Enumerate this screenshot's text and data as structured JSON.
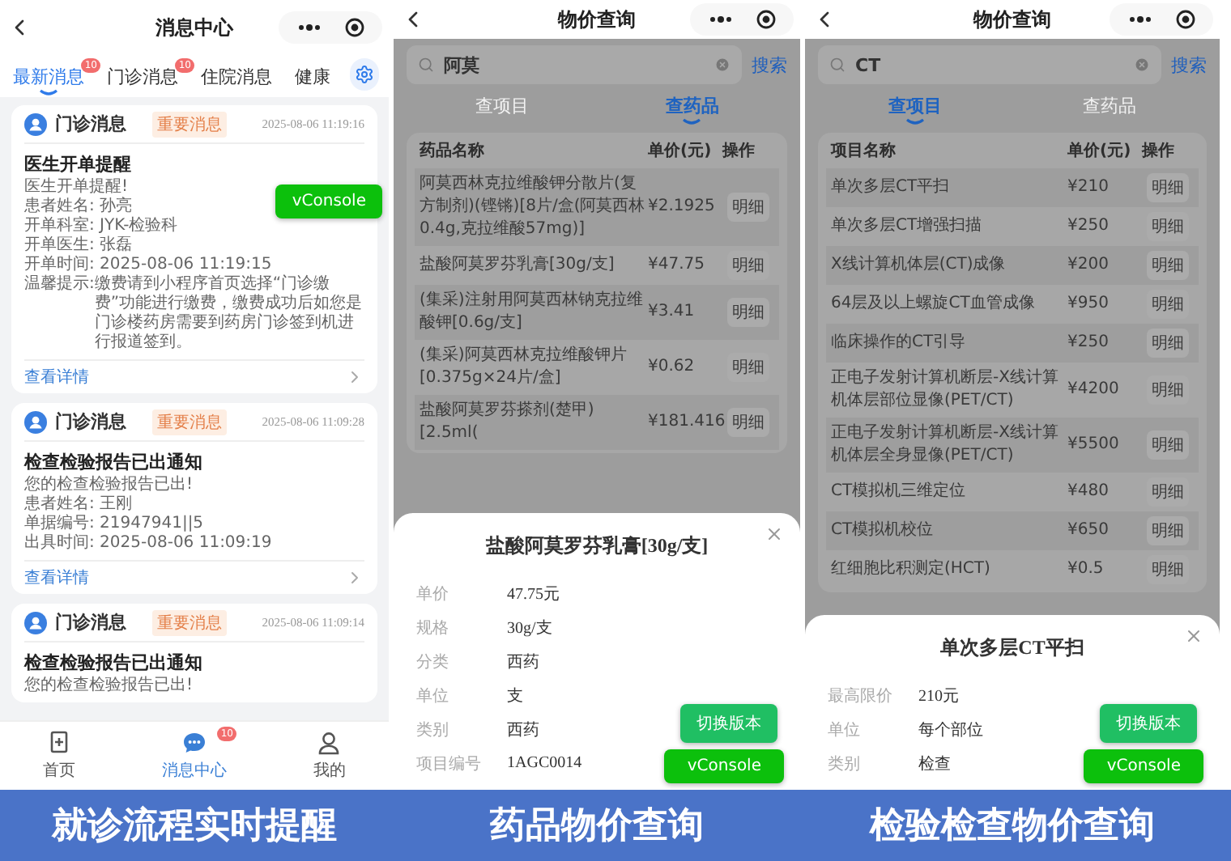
{
  "panels": [
    {
      "kind": "messages",
      "title": "消息中心",
      "caption": "就诊流程实时提醒",
      "tabs": [
        {
          "label": "最新消息",
          "selected": true,
          "badge": "10"
        },
        {
          "label": "门诊消息",
          "selected": false,
          "badge": "10"
        },
        {
          "label": "住院消息",
          "selected": false
        },
        {
          "label": "健康",
          "selected": false
        }
      ],
      "cards": [
        {
          "category": "门诊消息",
          "tag": "重要消息",
          "time": "2025-08-06 11:19:16",
          "heading": "医生开单提醒",
          "lines": [
            {
              "text": "医生开单提醒!"
            },
            {
              "text": "患者姓名: 孙亮"
            },
            {
              "text": "开单科室: JYK-检验科"
            },
            {
              "text": "开单医生: 张磊"
            },
            {
              "text": "开单时间: 2025-08-06 11:19:15"
            },
            {
              "label": "温馨提示:",
              "text": "缴费请到小程序首页选择“门诊缴费”功能进行缴费，缴费成功后如您是门诊楼药房需要到药房门诊签到机进行报道签到。"
            }
          ],
          "link": "查看详情"
        },
        {
          "category": "门诊消息",
          "tag": "重要消息",
          "time": "2025-08-06 11:09:28",
          "heading": "检查检验报告已出通知",
          "lines": [
            {
              "text": "您的检查检验报告已出!"
            },
            {
              "text": "患者姓名: 王刚"
            },
            {
              "text": "单据编号: 21947941||5"
            },
            {
              "text": "出具时间: 2025-08-06 11:09:19"
            }
          ],
          "link": "查看详情"
        },
        {
          "category": "门诊消息",
          "tag": "重要消息",
          "time": "2025-08-06 11:09:14",
          "heading": "检查检验报告已出通知",
          "lines": [
            {
              "text": "您的检查检验报告已出!"
            }
          ]
        }
      ],
      "nav": [
        {
          "label": "首页",
          "selected": false
        },
        {
          "label": "消息中心",
          "selected": true,
          "badge": "10"
        },
        {
          "label": "我的",
          "selected": false
        }
      ],
      "buttons": [
        {
          "label": "vConsole",
          "kind": "console"
        }
      ]
    },
    {
      "kind": "price",
      "title": "物价查询",
      "caption": "药品物价查询",
      "query": "阿莫",
      "search_button": "搜索",
      "tabs": [
        {
          "label": "查项目",
          "selected": false
        },
        {
          "label": "查药品",
          "selected": true
        }
      ],
      "columns": [
        "药品名称",
        "单价(元)",
        "操作"
      ],
      "rows": [
        {
          "name": "阿莫西林克拉维酸钾分散片(复方制剂)(铿锵)[8片/盒(阿莫西林0.4g,克拉维酸57mg)]",
          "price": "¥2.1925",
          "action": "明细"
        },
        {
          "name": "盐酸阿莫罗芬乳膏[30g/支]",
          "price": "¥47.75",
          "action": "明细"
        },
        {
          "name": "(集采)注射用阿莫西林钠克拉维酸钾[0.6g/支]",
          "price": "¥3.41",
          "action": "明细"
        },
        {
          "name": "(集采)阿莫西林克拉维酸钾片[0.375g×24片/盒]",
          "price": "¥0.62",
          "action": "明细"
        },
        {
          "name": "盐酸阿莫罗芬搽剂(楚甲)[2.5ml(",
          "price": "¥181.416",
          "action": "明细"
        }
      ],
      "sheet": {
        "title": "盐酸阿莫罗芬乳膏[30g/支]",
        "fields": [
          {
            "label": "单价",
            "value": "47.75元"
          },
          {
            "label": "规格",
            "value": "30g/支"
          },
          {
            "label": "分类",
            "value": "西药"
          },
          {
            "label": "单位",
            "value": "支"
          },
          {
            "label": "类别",
            "value": "西药"
          },
          {
            "label": "项目编号",
            "value": "1AGC0014"
          }
        ]
      },
      "buttons": [
        {
          "label": "切换版本",
          "kind": "switch"
        },
        {
          "label": "vConsole",
          "kind": "console"
        }
      ]
    },
    {
      "kind": "price",
      "title": "物价查询",
      "caption": "检验检查物价查询",
      "query": "CT",
      "search_button": "搜索",
      "tabs": [
        {
          "label": "查项目",
          "selected": true
        },
        {
          "label": "查药品",
          "selected": false
        }
      ],
      "columns": [
        "项目名称",
        "单价(元)",
        "操作"
      ],
      "rows": [
        {
          "name": "单次多层CT平扫",
          "price": "¥210",
          "action": "明细"
        },
        {
          "name": "单次多层CT增强扫描",
          "price": "¥250",
          "action": "明细"
        },
        {
          "name": "X线计算机体层(CT)成像",
          "price": "¥200",
          "action": "明细"
        },
        {
          "name": "64层及以上螺旋CT血管成像",
          "price": "¥950",
          "action": "明细"
        },
        {
          "name": "临床操作的CT引导",
          "price": "¥250",
          "action": "明细"
        },
        {
          "name": "正电子发射计算机断层-X线计算机体层部位显像(PET/CT)",
          "price": "¥4200",
          "action": "明细"
        },
        {
          "name": "正电子发射计算机断层-X线计算机体层全身显像(PET/CT)",
          "price": "¥5500",
          "action": "明细"
        },
        {
          "name": "CT模拟机三维定位",
          "price": "¥480",
          "action": "明细"
        },
        {
          "name": "CT模拟机校位",
          "price": "¥650",
          "action": "明细"
        },
        {
          "name": "红细胞比积测定(HCT)",
          "price": "¥0.5",
          "action": "明细"
        }
      ],
      "sheet": {
        "title": "单次多层CT平扫",
        "fields": [
          {
            "label": "最高限价",
            "value": "210元"
          },
          {
            "label": "单位",
            "value": "每个部位"
          },
          {
            "label": "类别",
            "value": "检查"
          }
        ]
      },
      "buttons": [
        {
          "label": "切换版本",
          "kind": "switch"
        },
        {
          "label": "vConsole",
          "kind": "console"
        }
      ]
    }
  ]
}
